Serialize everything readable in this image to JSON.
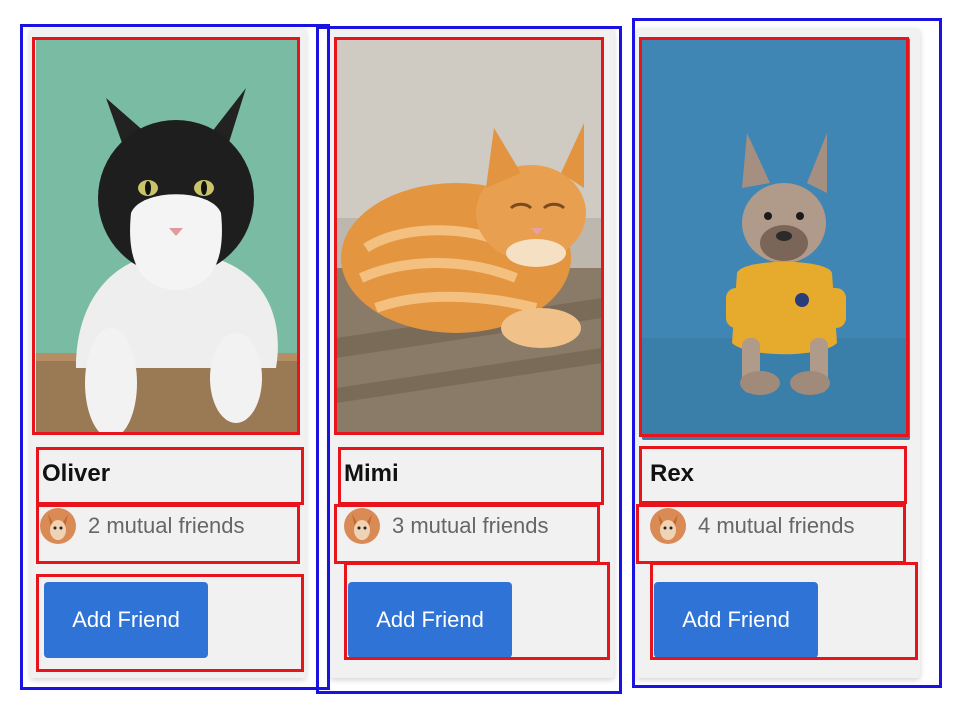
{
  "cards": [
    {
      "name": "Oliver",
      "mutual_text": "2 mutual friends",
      "button_label": "Add Friend",
      "photo": "cat-tuxedo-photo"
    },
    {
      "name": "Mimi",
      "mutual_text": "3 mutual friends",
      "button_label": "Add Friend",
      "photo": "cat-orange-tabby-photo"
    },
    {
      "name": "Rex",
      "mutual_text": "4 mutual friends",
      "button_label": "Add Friend",
      "photo": "french-bulldog-yellow-shirt-photo"
    }
  ],
  "colors": {
    "button": "#2f73d6",
    "annotation_element": "#e8141c",
    "annotation_card": "#1a12e0"
  }
}
